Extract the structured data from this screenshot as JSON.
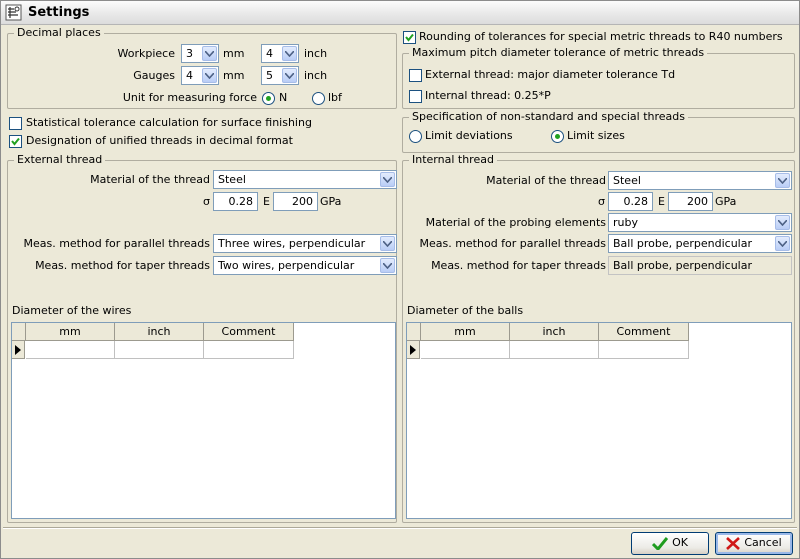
{
  "window": {
    "title": "Settings"
  },
  "decimal": {
    "legend": "Decimal places",
    "workpiece_label": "Workpiece",
    "workpiece_mm": "3",
    "workpiece_inch": "4",
    "gauges_label": "Gauges",
    "gauges_mm": "4",
    "gauges_inch": "5",
    "unit_mm": "mm",
    "unit_inch": "inch",
    "force_label": "Unit for measuring force",
    "force_n": "N",
    "force_lbf": "lbf"
  },
  "options": {
    "statistical": "Statistical tolerance calculation for surface finishing",
    "unified": "Designation of unified threads in decimal format",
    "rounding": "Rounding of tolerances for special metric threads to R40 numbers"
  },
  "pitch": {
    "legend": "Maximum pitch diameter tolerance of metric threads",
    "external": "External thread: major diameter tolerance Td",
    "internal": "Internal thread: 0.25*P"
  },
  "spec": {
    "legend": "Specification of non-standard and special threads",
    "deviations": "Limit deviations",
    "sizes": "Limit sizes"
  },
  "external": {
    "legend": "External thread",
    "material_label": "Material of the thread",
    "material": "Steel",
    "sigma_label": "σ",
    "sigma": "0.28",
    "e_label": "E",
    "e": "200",
    "unit": "GPa",
    "parallel_label": "Meas. method for parallel threads",
    "parallel": "Three wires, perpendicular",
    "taper_label": "Meas. method for taper threads",
    "taper": "Two wires, perpendicular",
    "table_title": "Diameter of the wires",
    "columns": [
      "mm",
      "inch",
      "Comment"
    ]
  },
  "internal": {
    "legend": "Internal thread",
    "material_label": "Material of the thread",
    "material": "Steel",
    "sigma_label": "σ",
    "sigma": "0.28",
    "e_label": "E",
    "e": "200",
    "unit": "GPa",
    "probing_label": "Material of the probing elements",
    "probing": "ruby",
    "parallel_label": "Meas. method for parallel threads",
    "parallel": "Ball probe, perpendicular",
    "taper_label": "Meas. method for taper threads",
    "taper": "Ball probe, perpendicular",
    "table_title": "Diameter of the balls",
    "columns": [
      "mm",
      "inch",
      "Comment"
    ]
  },
  "buttons": {
    "ok": "OK",
    "cancel": "Cancel"
  },
  "colors": {
    "check": "#21a121",
    "ok_icon": "#1f9c1f",
    "cancel_icon": "#d01818",
    "accent": "#7f9db9"
  }
}
